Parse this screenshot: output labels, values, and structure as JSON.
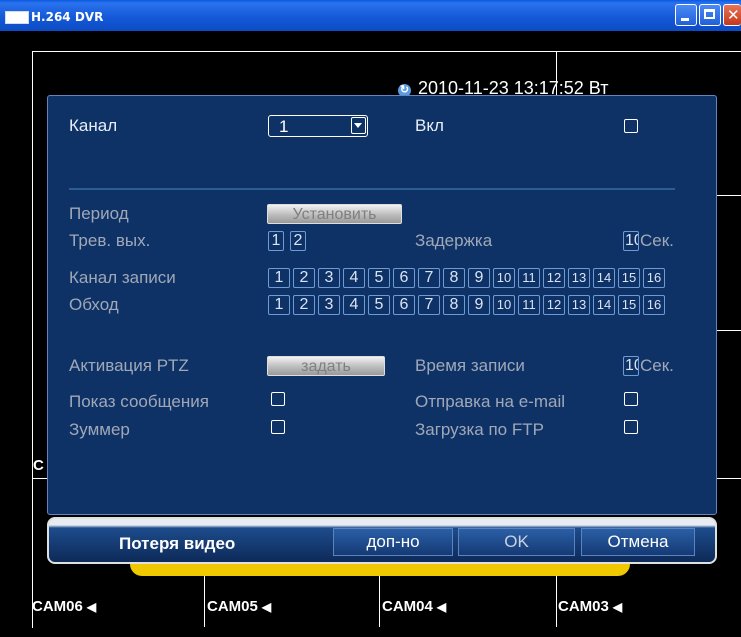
{
  "window": {
    "title": "H.264 DVR"
  },
  "overlay": {
    "datetime": "2010-11-23 13:17:52 Вт"
  },
  "background": {
    "left_label": "C",
    "cameras": [
      {
        "label": "CAM06",
        "icon": "speaker-icon"
      },
      {
        "label": "CAM05",
        "icon": "speaker-icon"
      },
      {
        "label": "CAM04",
        "icon": "speaker-icon"
      },
      {
        "label": "CAM03",
        "icon": "speaker-icon"
      }
    ]
  },
  "dialog": {
    "channel_label": "Канал",
    "channel_value": "1",
    "enable_label": "Вкл",
    "enable_checked": false,
    "period_label": "Период",
    "period_button": "Установить",
    "alarm_out_label": "Трев. вых.",
    "alarm_outs": [
      "1",
      "2"
    ],
    "delay_label": "Задержка",
    "delay_value": "10",
    "delay_unit": "Сек.",
    "record_channel_label": "Канал записи",
    "record_channels": [
      "1",
      "2",
      "3",
      "4",
      "5",
      "6",
      "7",
      "8",
      "9",
      "10",
      "11",
      "12",
      "13",
      "14",
      "15",
      "16"
    ],
    "tour_label": "Обход",
    "tour_channels": [
      "1",
      "2",
      "3",
      "4",
      "5",
      "6",
      "7",
      "8",
      "9",
      "10",
      "11",
      "12",
      "13",
      "14",
      "15",
      "16"
    ],
    "ptz_label": "Активация PTZ",
    "ptz_button": "задать",
    "record_time_label": "Время записи",
    "record_time_value": "10",
    "record_time_unit": "Сек.",
    "show_message_label": "Показ сообщения",
    "send_email_label": "Отправка на e-mail",
    "buzzer_label": "Зуммер",
    "ftp_label": "Загрузка по FTP"
  },
  "footer": {
    "title": "Потеря видео",
    "more_button": "доп-но",
    "ok_button": "OK",
    "cancel_button": "Отмена"
  },
  "colors": {
    "dialog_bg": "#0f3266",
    "accent": "#f0c800",
    "titlebar": "#1559d8"
  }
}
